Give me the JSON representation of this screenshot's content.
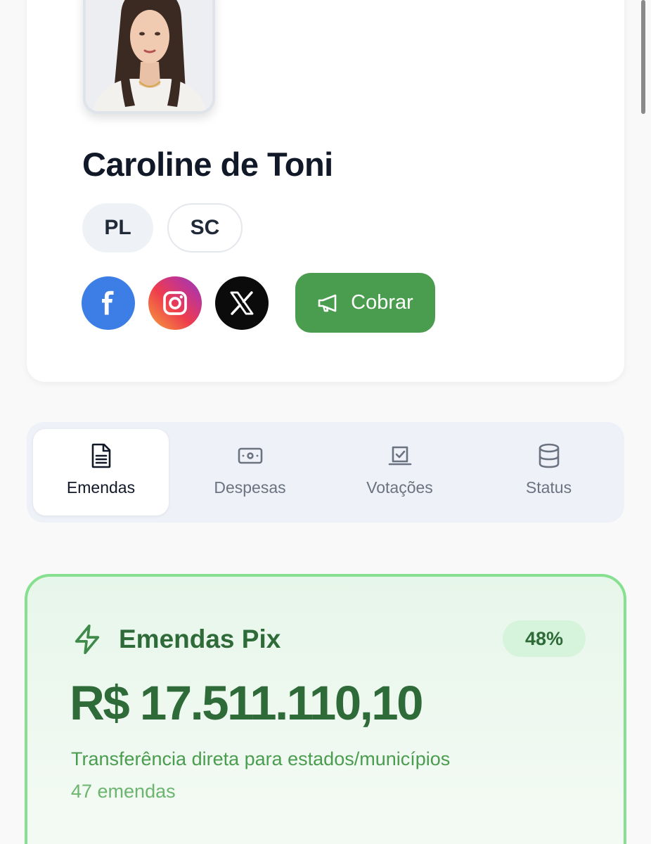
{
  "profile": {
    "name": "Caroline de Toni",
    "party": "PL",
    "state": "SC",
    "avatar_icon": "person-photo",
    "socials": [
      {
        "network": "facebook",
        "icon": "facebook-icon"
      },
      {
        "network": "instagram",
        "icon": "instagram-icon"
      },
      {
        "network": "x",
        "icon": "x-icon"
      }
    ],
    "cobrar_label": "Cobrar",
    "cobrar_icon": "megaphone-icon"
  },
  "tabs": [
    {
      "label": "Emendas",
      "icon": "document-icon",
      "active": true
    },
    {
      "label": "Despesas",
      "icon": "banknote-icon",
      "active": false
    },
    {
      "label": "Votações",
      "icon": "ballot-box-icon",
      "active": false
    },
    {
      "label": "Status",
      "icon": "database-icon",
      "active": false
    }
  ],
  "pix_card": {
    "icon": "lightning-icon",
    "title": "Emendas Pix",
    "badge": "48%",
    "amount": "R$ 17.511.110,10",
    "description": "Transferência direta para estados/municípios",
    "count_label": "47 emendas"
  },
  "colors": {
    "accent_green": "#4a9d4e",
    "dark_green": "#2e6b39",
    "card_border": "#86e08f",
    "facebook": "#3d7ee6",
    "x": "#0b0b0b"
  }
}
